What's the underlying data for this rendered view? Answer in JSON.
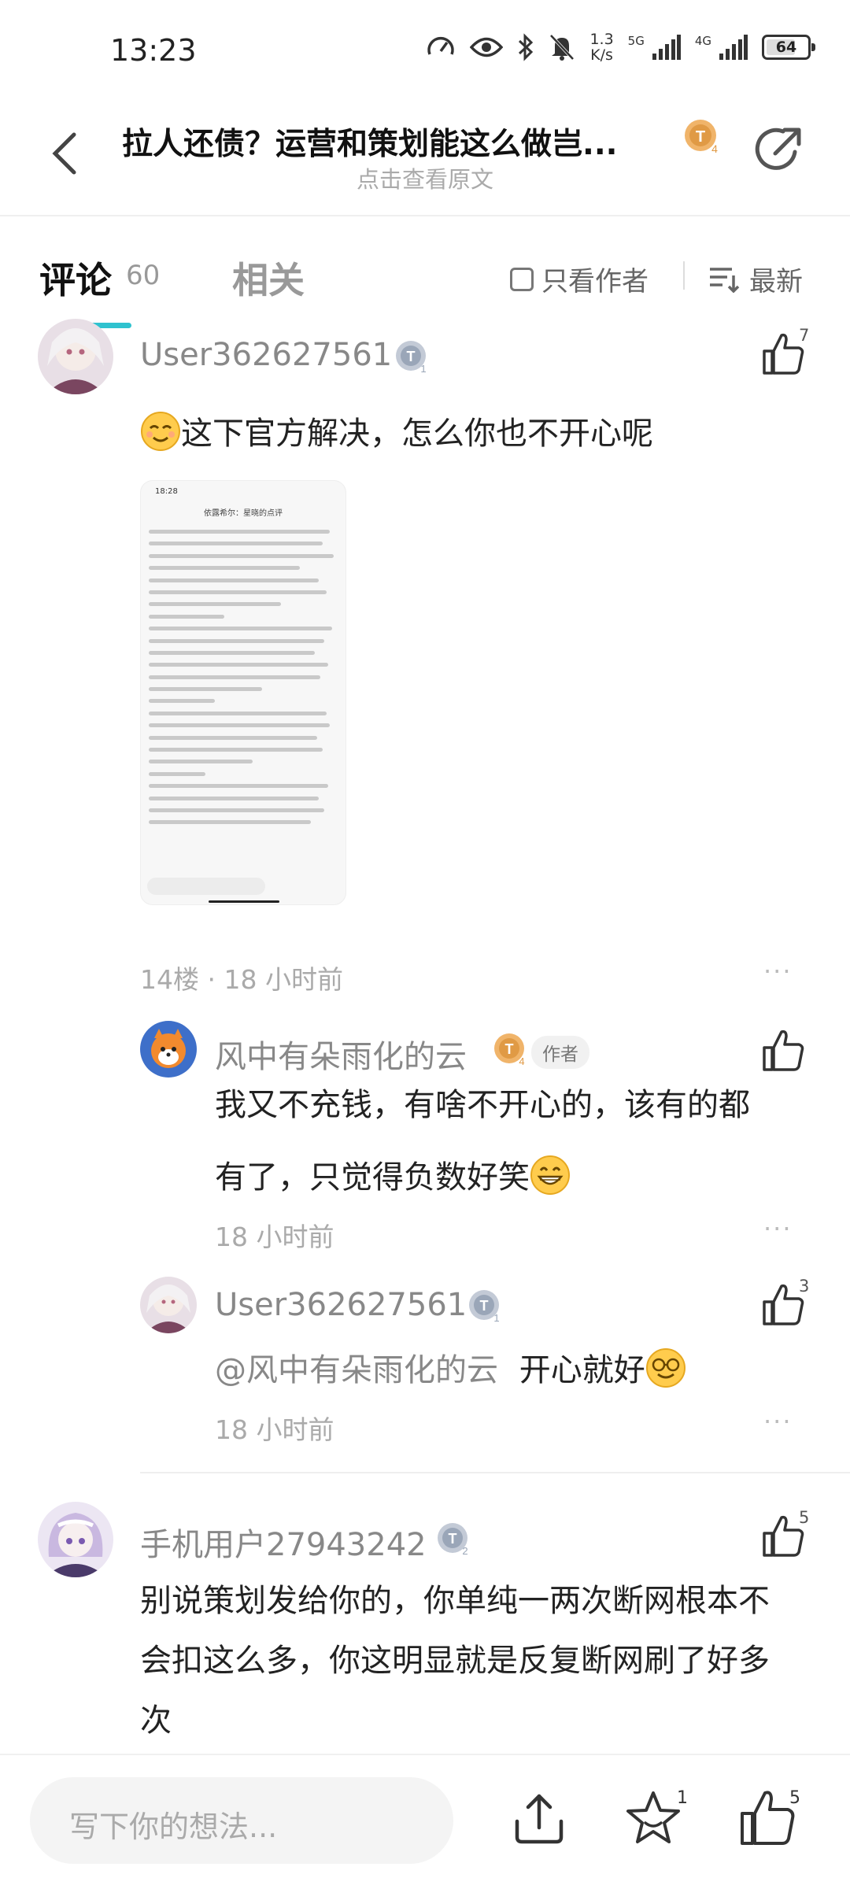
{
  "status_bar": {
    "time": "13:23",
    "net_speed_value": "1.3",
    "net_speed_unit": "K/s",
    "sig1_label": "5G",
    "sig2_label": "4G",
    "battery": "64",
    "icons": [
      "speed-icon",
      "eye-icon",
      "bluetooth-icon",
      "mute-bell-icon",
      "signal-icon",
      "signal-icon",
      "battery-icon"
    ]
  },
  "header": {
    "title": "拉人还债？运营和策划能这么做岂...",
    "subtitle": "点击查看原文",
    "badge": "T4"
  },
  "tabs": {
    "comments_label": "评论",
    "comments_count": "60",
    "related_label": "相关",
    "author_only_label": "只看作者",
    "sort_label": "最新"
  },
  "comments": [
    {
      "user": "User362627561",
      "level": "T1",
      "likes": "7",
      "text": "这下官方解决，怎么你也不开心呢",
      "meta": "14楼 · 18 小时前",
      "more": "···",
      "image": {
        "time": "18:28",
        "title": "依露希尔：星晓的点评"
      },
      "replies": [
        {
          "user": "风中有朵雨化的云",
          "level": "T4",
          "author_tag": "作者",
          "likes": "",
          "line1": "我又不充钱，有啥不开心的，该有的都",
          "line2": "有了，只觉得负数好笑",
          "meta": "18 小时前",
          "more": "···"
        },
        {
          "user": "User362627561",
          "level": "T1",
          "likes": "3",
          "mention": "@风中有朵雨化的云",
          "text": "开心就好",
          "meta": "18 小时前",
          "more": "···"
        }
      ]
    },
    {
      "user": "手机用户27943242",
      "level": "T2",
      "likes": "5",
      "line1": "别说策划发给你的，你单纯一两次断网根本不",
      "line2": "会扣这么多，你这明显就是反复断网刷了好多",
      "line3": "次"
    }
  ],
  "bottom_bar": {
    "input_placeholder": "写下你的想法...",
    "star_count": "1",
    "like_count": "5"
  },
  "colors": {
    "accent": "#2fc2cf",
    "gold_badge": "#e9a95b",
    "silver_badge": "#9aa6b8"
  }
}
